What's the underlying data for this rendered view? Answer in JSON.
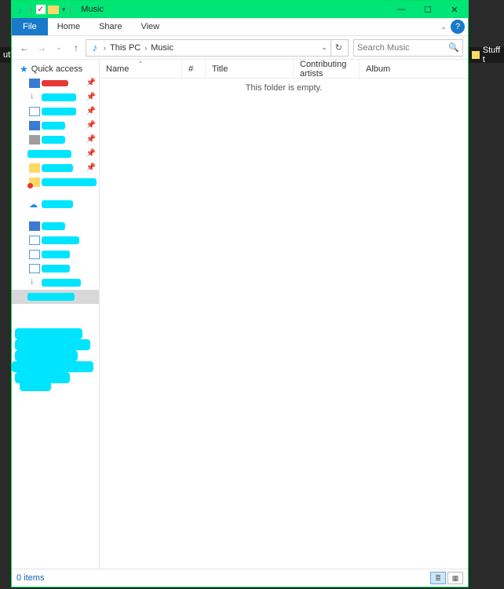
{
  "bg": {
    "left_text": "utl",
    "right_text": "Stuff t"
  },
  "titlebar": {
    "title": "Music"
  },
  "ribbon": {
    "file": "File",
    "tabs": [
      "Home",
      "Share",
      "View"
    ]
  },
  "breadcrumbs": [
    "This PC",
    "Music"
  ],
  "search": {
    "placeholder": "Search Music"
  },
  "columns": {
    "name": "Name",
    "num": "#",
    "title": "Title",
    "contrib": "Contributing artists",
    "album": "Album"
  },
  "empty_message": "This folder is empty.",
  "sidebar": {
    "quick_access": "Quick access"
  },
  "status": {
    "items": "0 items"
  }
}
